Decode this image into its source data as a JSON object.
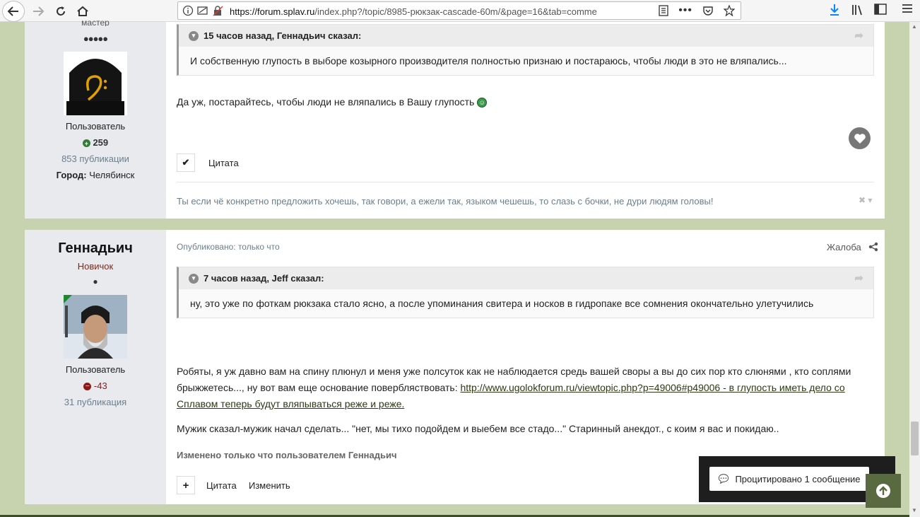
{
  "browser": {
    "url_host": "https://forum.splav.ru",
    "url_rest": "/index.php?/topic/8985-рюкзак-cascade-60m/&page=16&tab=comme"
  },
  "post1": {
    "author_rank_partial": "мастер",
    "rank_dots": "●●●●●",
    "group": "Пользователь",
    "reputation": "259",
    "posts_count": "853 публикации",
    "city_label": "Город:",
    "city_value": "Челябинск",
    "quote_header": "15 часов назад, Геннадьич сказал:",
    "quote_body": "И собственную глупость в выборе козырного производителя полностью признаю и постараюсь, чтобы люди в это не вляпались...",
    "text": "Да уж, постарайтесь, чтобы люди не вляпались в Вашу глупость",
    "quote_action": "Цитата",
    "signature": "Ты если чё конкретно предложить хочешь, так говори, а ежели так, языком чешешь, то слазь с бочки, не дури людям головы!"
  },
  "post2": {
    "author_name": "Геннадьич",
    "author_rank": "Новичок",
    "rank_dots": "●",
    "group": "Пользователь",
    "reputation": "-43",
    "posts_count": "31 публикация",
    "published": "Опубликовано: только что",
    "report": "Жалоба",
    "quote_header": "7 часов назад, Jeff сказал:",
    "quote_body": "ну, это уже по фоткам рюкзака стало ясно, а после упоминания свитера и носков в гидропаке все сомнения окончательно улетучились",
    "para1_line1": "Робяты, я уж давно вам на спину плюнул и меня уже полсуток как не наблюдается средь вашей своры а вы до сих пор кто слюнями , кто соплями",
    "para1_line2": "брыжжетесь..., ну вот вам еще основание повербляствовать: ",
    "link_line1": "http://www.ugolokforum.ru/viewtopic.php?p=49006#p49006 - в глупость иметь дело со",
    "link_line2": "Сплавом теперь будут вляпываться реже и реже.",
    "para2": "Мужик сказал-мужик начал сделать... \"нет, мы тихо подойдем и выебем все стадо...\" Старинный анекдот., с коим я вас и покидаю..",
    "edited": "Изменено только что пользователем Геннадьич",
    "quote_action": "Цитата",
    "edit_action": "Изменить"
  },
  "floating": {
    "quoted_button": "Процитировано 1 сообщение"
  },
  "colors": {
    "page_bg": "#c7d3ae",
    "author_bg": "#e8eaee",
    "link": "#2a3a12",
    "reputation_positive": "#2e7d32",
    "reputation_negative": "#8b1a1a"
  }
}
